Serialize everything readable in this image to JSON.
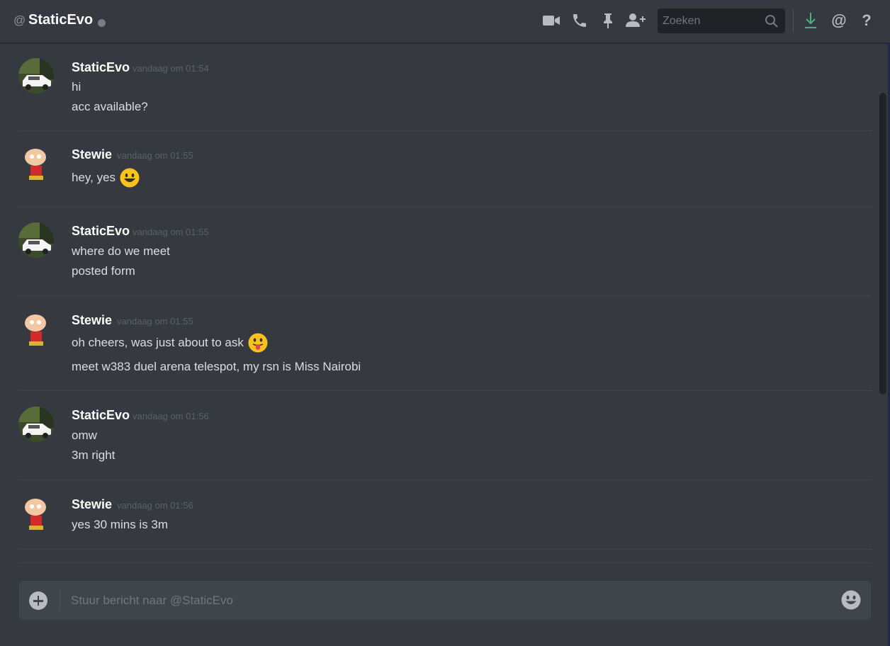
{
  "header": {
    "at_symbol": "@",
    "channel_name": "StaticEvo",
    "status_color": "#747f8d",
    "icons": [
      "video-call-icon",
      "voice-call-icon",
      "pin-icon",
      "add-friend-icon",
      "download-icon",
      "mention-icon",
      "help-icon"
    ],
    "search_placeholder": "Zoeken",
    "mention_label": "@",
    "help_label": "?"
  },
  "messages": [
    {
      "author": "StaticEvo",
      "timestamp": "vandaag om 01:54",
      "avatar": "car-avatar",
      "lines": [
        {
          "text": "hi"
        },
        {
          "text": "acc available?"
        }
      ]
    },
    {
      "author": "Stewie",
      "timestamp": "vandaag om 01:55",
      "avatar": "stewie-avatar",
      "lines": [
        {
          "text": "hey, yes",
          "emoji": "smiley"
        }
      ]
    },
    {
      "author": "StaticEvo",
      "timestamp": "vandaag om 01:55",
      "avatar": "car-avatar",
      "lines": [
        {
          "text": "where do we meet"
        },
        {
          "text": "posted form"
        }
      ]
    },
    {
      "author": "Stewie",
      "timestamp": "vandaag om 01:55",
      "avatar": "stewie-avatar",
      "lines": [
        {
          "text": "oh cheers, was just about to ask",
          "emoji": "stuck-out-tongue"
        },
        {
          "text": "meet w383 duel arena telespot, my rsn is Miss Nairobi"
        }
      ]
    },
    {
      "author": "StaticEvo",
      "timestamp": "vandaag om 01:56",
      "avatar": "car-avatar",
      "lines": [
        {
          "text": "omw"
        },
        {
          "text": "3m right"
        }
      ]
    },
    {
      "author": "Stewie",
      "timestamp": "vandaag om 01:56",
      "avatar": "stewie-avatar",
      "lines": [
        {
          "text": "yes 30 mins is 3m"
        }
      ]
    }
  ],
  "composer": {
    "placeholder": "Stuur bericht naar @StaticEvo",
    "icons": [
      "upload-icon",
      "emoji-picker-icon"
    ]
  },
  "colors": {
    "background": "#36393f",
    "accent_download": "#43b581",
    "text_primary": "#dcddde",
    "author": "#ffffff",
    "timestamp": "#5c6168"
  }
}
